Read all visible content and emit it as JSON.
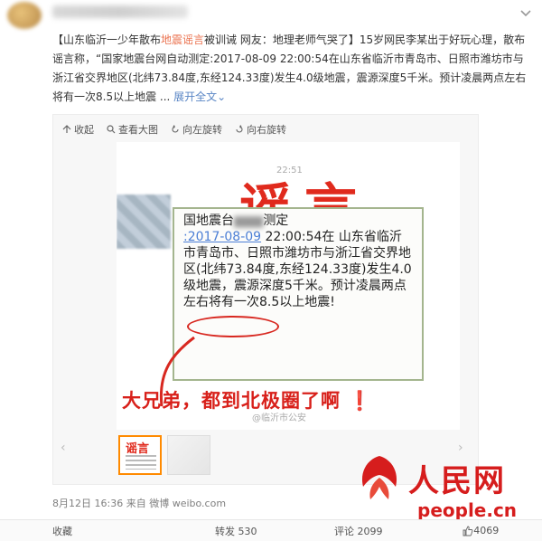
{
  "post": {
    "topic_left": "【山东临沂一少年散布",
    "topic_keyword": "地震谣言",
    "topic_right": "被训诫 网友：地理老师气哭了】",
    "body_1": "15岁网民李某出于好玩心理，散布谣言称，“国家地震台网自动测定:2017-08-09 22:00:54在山东省临沂市青岛市、日照市潍坊市与浙江省交界地区(北纬73.84度,东经124.33度)发生4.0级地震，震源深度5千米。预计凌晨两点左右将有一次8.5以上地震",
    "ellipsis": " ... ",
    "expand_label": "展开全文⌄"
  },
  "toolbar": {
    "collapse": "收起",
    "view_large": "查看大图",
    "rotate_left": "向左旋转",
    "rotate_right": "向右旋转"
  },
  "image": {
    "status_time": "22:51",
    "rumor_title": "谣言",
    "sms_line1": "国地震台",
    "sms_line1b": "测定",
    "sms_date": ":2017-08-09",
    "sms_time": " 22:00:54在",
    "sms_body": "山东省临沂市青岛市、日照市潍坊市与浙江省交界地区(北纬73.84度,东经124.33度)发生4.0级地震，震源深度5千米。预计凌晨两点左右将有一次8.5以上地震!",
    "caption": "大兄弟，都到北极圈了啊",
    "watermark": "@临沂市公安"
  },
  "thumb_title": "谣言",
  "meta": {
    "time": "8月12日 16:36",
    "from_label": "来自",
    "source": "微博 weibo.com"
  },
  "logo": {
    "text": "人民网",
    "url": "people.cn"
  },
  "footer": {
    "favorite": "收藏",
    "repost": "转发 530",
    "comment": "评论 2099",
    "like": "4069"
  },
  "colors": {
    "accent": "#eb7350",
    "link": "#5a86c5",
    "rumor_red": "#e02a1d",
    "logo_red": "#d61d1d"
  }
}
